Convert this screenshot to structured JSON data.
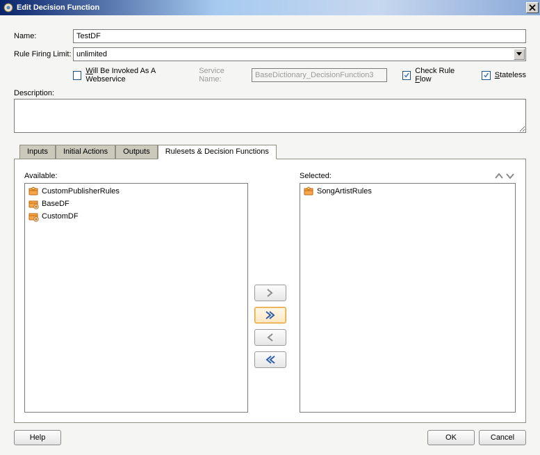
{
  "title": "Edit Decision Function",
  "form": {
    "name_label": "Name:",
    "name_value": "TestDF",
    "limit_label": "Rule Firing Limit:",
    "limit_value": "unlimited",
    "desc_label": "Description:",
    "desc_value": ""
  },
  "options": {
    "webservice_checked": false,
    "webservice_html": "<u>W</u>ill Be Invoked As A Webservice",
    "service_name_label": "Service Name:",
    "service_name_value": "BaseDictionary_DecisionFunction3",
    "check_rule_flow_checked": true,
    "check_rule_flow_html": "Check Rule <u>F</u>low",
    "stateless_checked": true,
    "stateless_html": "<u>S</u>tateless"
  },
  "tabs": [
    "Inputs",
    "Initial Actions",
    "Outputs",
    "Rulesets & Decision Functions"
  ],
  "active_tab": 3,
  "available_label": "Available:",
  "selected_label": "Selected:",
  "available": [
    {
      "icon": "ruleset",
      "label": "CustomPublisherRules"
    },
    {
      "icon": "df",
      "label": "BaseDF"
    },
    {
      "icon": "df",
      "label": "CustomDF"
    }
  ],
  "selected": [
    {
      "icon": "ruleset",
      "label": "SongArtistRules"
    }
  ],
  "footer": {
    "help": "Help",
    "ok": "OK",
    "cancel": "Cancel"
  }
}
